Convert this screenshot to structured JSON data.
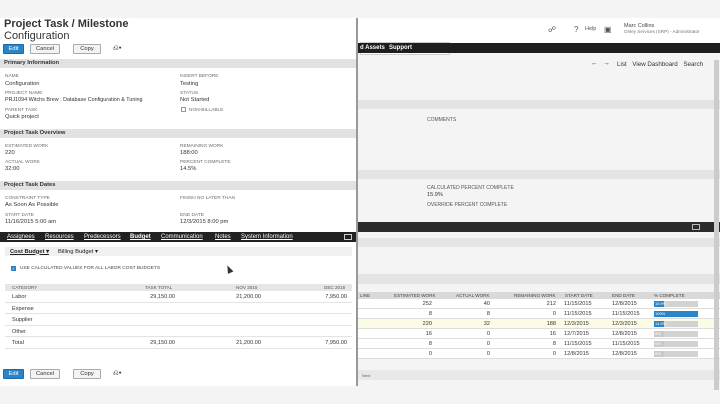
{
  "modal": {
    "title_line1": "Project Task / Milestone",
    "title_line2": "Configuration",
    "buttons": {
      "edit": "Edit",
      "cancel": "Cancel",
      "copy": "Copy",
      "actions_icon": "⎌▾"
    },
    "sections": {
      "primary": "Primary Information",
      "overview": "Project Task Overview",
      "dates": "Project Task Dates"
    },
    "primary": {
      "name_label": "Name",
      "name_value": "Configuration",
      "insert_before_label": "Insert Before",
      "insert_before_value": "Testing",
      "project_name_label": "Project Name",
      "project_name_value": "PRJ1094 Witchs Brew : Database Configuration & Tuning",
      "status_label": "Status",
      "status_value": "Not Started",
      "parent_task_label": "Parent Task",
      "parent_task_value": "Quick project",
      "non_billable_label": "Non-Billable"
    },
    "overview": {
      "estimated_work_label": "Estimated Work",
      "estimated_work_value": "220",
      "remaining_work_label": "Remaining Work",
      "remaining_work_value": "188:00",
      "actual_work_label": "Actual Work",
      "actual_work_value": "32:00",
      "percent_complete_label": "Percent Complete",
      "percent_complete_value": "14.5%"
    },
    "dates": {
      "constraint_type_label": "Constraint Type",
      "constraint_type_value": "As Soon As Possible",
      "finish_no_later_label": "Finish No Later Than",
      "start_date_label": "Start Date",
      "start_date_value": "11/16/2015 5:00 am",
      "end_date_label": "End Date",
      "end_date_value": "12/3/2015 8:00 pm"
    },
    "tabs": [
      "Assignees",
      "Resources",
      "Predecessors",
      "Budget",
      "Communication",
      "Notes",
      "System Information"
    ],
    "subtabs": [
      "Cost Budget ▾",
      "Billing Budget ▾"
    ],
    "budget_checkbox_label": "Use calculated values for all labor cost budgets",
    "budget_table": {
      "headers": [
        "Category",
        "Task Total",
        "Nov 2015",
        "Dec 2015"
      ],
      "rows": [
        [
          "Labor",
          "29,150.00",
          "21,200.00",
          "7,950.00"
        ],
        [
          "Expense",
          "",
          "",
          ""
        ],
        [
          "Supplier",
          "",
          "",
          ""
        ],
        [
          "Other",
          "",
          "",
          ""
        ],
        [
          "Total",
          "29,150.00",
          "21,200.00",
          "7,950.00"
        ]
      ]
    }
  },
  "background": {
    "search_icon": "🔍",
    "help_label": "Help",
    "user_name": "Marc Collins",
    "user_sub": "Onley Services (SRP) - Administrator",
    "nav_items": [
      "d Assets",
      "Support"
    ],
    "links": [
      "List",
      "View Dashboard",
      "Search"
    ],
    "comments_label": "Comments",
    "calc_percent_label": "Calculated Percent Complete",
    "calc_percent_value": "15.9%",
    "override_percent_label": "Override Percent Complete",
    "table_headers": [
      "Line",
      "Estimated Work",
      "Actual Work",
      "Remaining Work",
      "Start Date",
      "End Date",
      "% Complete"
    ],
    "table_rows": [
      {
        "est": "252",
        "act": "40",
        "rem": "212",
        "start": "11/15/2015",
        "end": "12/8/2015",
        "pct": 15.9,
        "pct_label": "15.9%"
      },
      {
        "est": "8",
        "act": "8",
        "rem": "0",
        "start": "11/15/2015",
        "end": "11/15/2015",
        "pct": 100,
        "pct_label": "100%"
      },
      {
        "est": "220",
        "act": "32",
        "rem": "188",
        "start": "12/3/2015",
        "end": "12/3/2015",
        "pct": 14.5,
        "pct_label": "14.5%"
      },
      {
        "est": "16",
        "act": "0",
        "rem": "16",
        "start": "12/7/2015",
        "end": "12/8/2015",
        "pct": 0,
        "pct_label": "0%"
      },
      {
        "est": "8",
        "act": "0",
        "rem": "8",
        "start": "11/15/2015",
        "end": "11/15/2015",
        "pct": 0,
        "pct_label": "0%"
      },
      {
        "est": "0",
        "act": "0",
        "rem": "0",
        "start": "12/8/2015",
        "end": "12/8/2015",
        "pct": 0,
        "pct_label": "0%"
      }
    ],
    "footer_text": "Next"
  }
}
